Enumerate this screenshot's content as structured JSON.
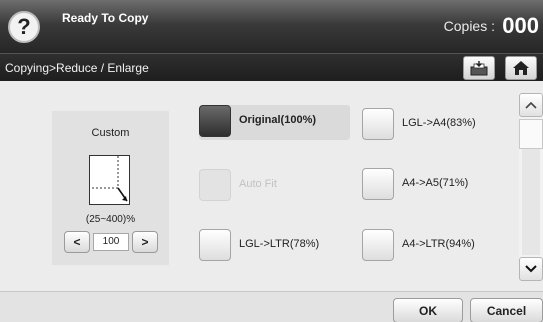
{
  "header": {
    "help_icon": "question-mark-icon",
    "help_glyph": "?",
    "status": "Ready To Copy",
    "copies_label": "Copies :",
    "copies_value": "000"
  },
  "breadcrumb": {
    "path": "Copying>Reduce / Enlarge",
    "tools": [
      "save-to-box-icon",
      "home-icon"
    ]
  },
  "custom": {
    "title": "Custom",
    "range": "(25~400)%",
    "decrement": "<",
    "increment": ">",
    "value": "100"
  },
  "options": [
    {
      "label": "Original(100%)",
      "state": "selected"
    },
    {
      "label": "LGL->A4(83%)",
      "state": "normal"
    },
    {
      "label": "Auto Fit",
      "state": "disabled"
    },
    {
      "label": "A4->A5(71%)",
      "state": "normal"
    },
    {
      "label": "LGL->LTR(78%)",
      "state": "normal"
    },
    {
      "label": "A4->LTR(94%)",
      "state": "normal"
    }
  ],
  "footer": {
    "ok_label": "OK",
    "cancel_label": "Cancel"
  },
  "colors": {
    "header_dark": "#262626",
    "panel_bg": "#ececec",
    "selected_button": "#3c3c3c"
  }
}
